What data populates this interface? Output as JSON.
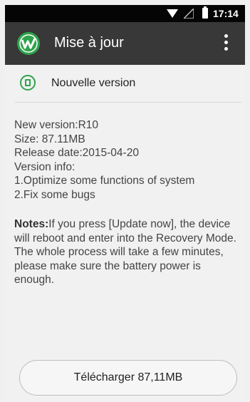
{
  "status_bar": {
    "time": "17:14",
    "icons": [
      "wifi-icon",
      "signal-icon",
      "battery-icon"
    ]
  },
  "app_bar": {
    "title": "Mise à jour",
    "logo_icon": "app-logo-icon",
    "menu_icon": "overflow-menu-icon"
  },
  "section": {
    "icon": "document-icon",
    "label": "Nouvelle version"
  },
  "info_lines": [
    "New version:R10",
    "Size: 87.11MB",
    "Release date:2015-04-20",
    "Version info:",
    "1.Optimize some functions of system",
    "2.Fix some bugs"
  ],
  "notes": {
    "label": "Notes:",
    "text": "If you press [Update now], the device will reboot and enter into the Recovery Mode. The whole process will take a few minutes, please make sure the battery power is enough."
  },
  "download_button": {
    "label": "Télécharger  87,11MB"
  },
  "colors": {
    "accent_green": "#2ea34b",
    "app_bar": "#383838",
    "status_bar": "#050505",
    "background": "#f1f1f1"
  }
}
